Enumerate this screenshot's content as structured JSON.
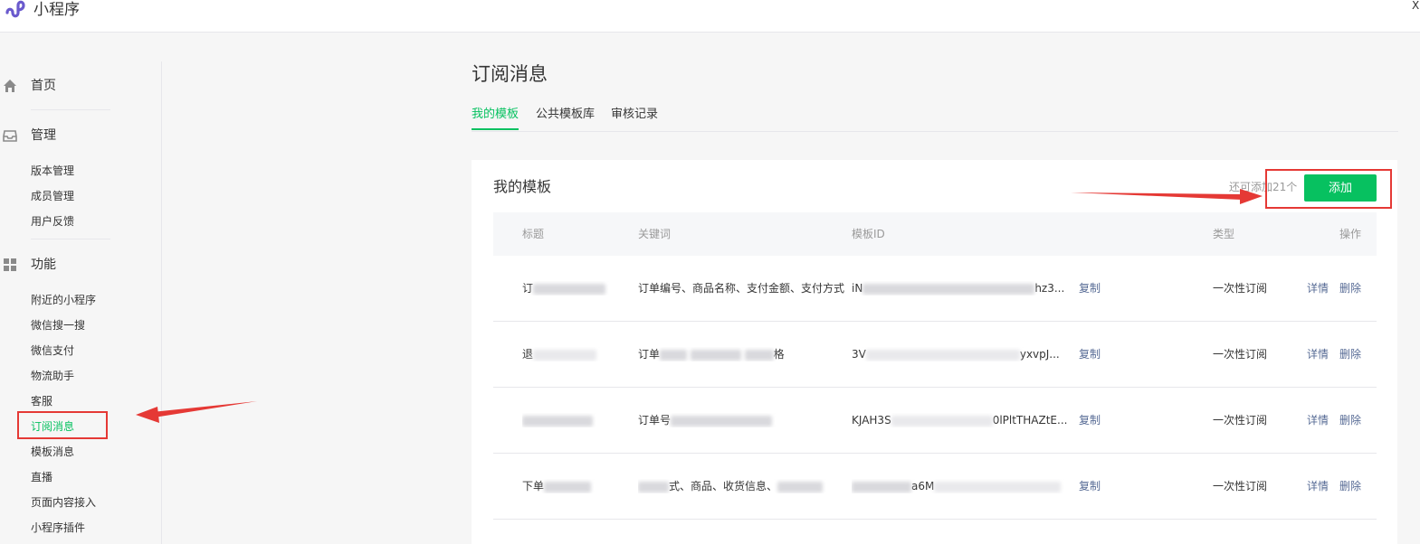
{
  "app": {
    "title": "小程序",
    "corner_mark": "X"
  },
  "sidebar": {
    "home": {
      "label": "首页",
      "icon": "home-icon"
    },
    "manage": {
      "label": "管理",
      "icon": "inbox-icon",
      "items": [
        "版本管理",
        "成员管理",
        "用户反馈"
      ]
    },
    "features": {
      "label": "功能",
      "icon": "grid-icon",
      "items": [
        "附近的小程序",
        "微信搜一搜",
        "微信支付",
        "物流助手",
        "客服",
        "订阅消息",
        "模板消息",
        "直播",
        "页面内容接入",
        "小程序插件"
      ],
      "active": "订阅消息"
    }
  },
  "main": {
    "title": "订阅消息",
    "tabs": [
      "我的模板",
      "公共模板库",
      "审核记录"
    ],
    "active_tab": "我的模板"
  },
  "card": {
    "title": "我的模板",
    "remaining": "还可添加21个",
    "add_label": "添加",
    "columns": [
      "标题",
      "关键词",
      "模板ID",
      "类型",
      "操作"
    ],
    "rows": [
      {
        "title": "订",
        "keywords": "订单编号、商品名称、支付金额、支付方式",
        "template_id": "iN",
        "template_id_tail": "hz3...",
        "copy": "复制",
        "type": "一次性订阅",
        "detail": "详情",
        "delete": "删除"
      },
      {
        "title": "退",
        "keywords": "订单",
        "keywords_tail": "格",
        "template_id": "3V",
        "template_id_tail": "yxvpJ...",
        "copy": "复制",
        "type": "一次性订阅",
        "detail": "详情",
        "delete": "删除"
      },
      {
        "title": "",
        "keywords": "订单号",
        "template_id": "KJAH3S",
        "template_id_tail": "0lPltTHAZtE...",
        "copy": "复制",
        "type": "一次性订阅",
        "detail": "详情",
        "delete": "删除"
      },
      {
        "title": "下单",
        "keywords": "式、商品、收货信息、",
        "template_id": "",
        "template_id_tail": "a6M",
        "copy": "复制",
        "type": "一次性订阅",
        "detail": "详情",
        "delete": "删除"
      }
    ]
  },
  "colors": {
    "accent": "#07c160",
    "link": "#576b95",
    "annotation": "#e53935"
  }
}
